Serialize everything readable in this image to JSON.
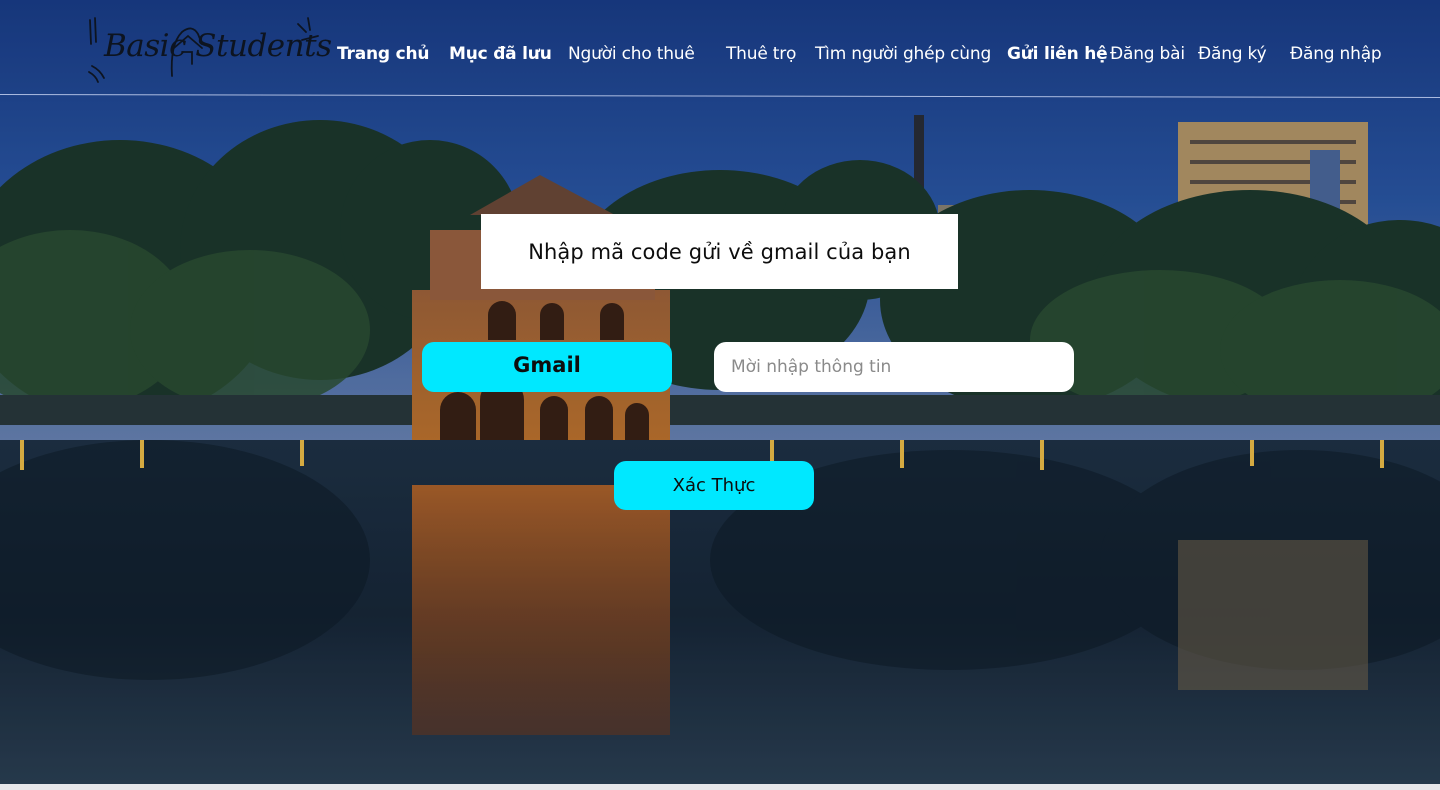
{
  "brand": {
    "logo_text": "Basic Students"
  },
  "nav": {
    "items": [
      {
        "label": "Trang chủ"
      },
      {
        "label": "Mục đã lưu"
      },
      {
        "label": "Người cho thuê"
      },
      {
        "label": "Thuê trọ"
      },
      {
        "label": "Tìm người ghép cùng"
      },
      {
        "label": "Gửi liên hệ"
      },
      {
        "label": "Đăng bài"
      },
      {
        "label": "Đăng ký"
      },
      {
        "label": "Đăng nhập"
      }
    ]
  },
  "form": {
    "title": "Nhập mã code gửi về gmail của bạn",
    "field_label": "Gmail",
    "input_placeholder": "Mời nhập thông tin",
    "input_value": "",
    "submit_label": "Xác Thực"
  },
  "colors": {
    "accent": "#00e8ff",
    "card": "#ffffff",
    "nav_text": "#ffffff"
  }
}
